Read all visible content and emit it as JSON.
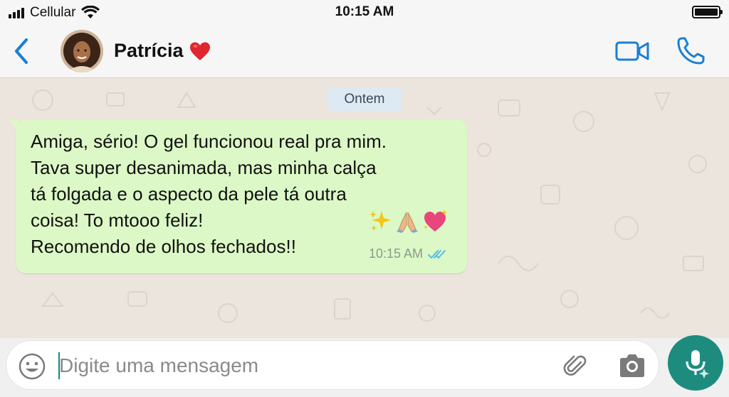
{
  "status_bar": {
    "carrier": "Cellular",
    "time": "10:15 AM",
    "battery_level": 1.0
  },
  "header": {
    "contact_name": "Patrícia",
    "back_icon": "chevron-left-icon",
    "video_icon": "video-camera-icon",
    "call_icon": "phone-icon"
  },
  "chat": {
    "date_chip": "Ontem",
    "messages": [
      {
        "text": "Amiga, sério! O gel funcionou real pra mim.\nTava super desanimada, mas minha calça\ntá folgada e o aspecto da pele tá outra\ncoisa! To mtooo feliz!\nRecomendo de olhos fechados!!",
        "emojis": [
          "sparkles",
          "folded-hands",
          "sparkling-heart"
        ],
        "time": "10:15 AM",
        "status": "read"
      }
    ]
  },
  "input_bar": {
    "placeholder": "Digite uma mensagem",
    "value": ""
  },
  "colors": {
    "accent": "#1a7fd4",
    "bubble_out": "#dcf8c6",
    "chat_bg": "#ece5dd",
    "mic_button": "#1d8c7e",
    "read_ticks": "#53bdeb"
  }
}
